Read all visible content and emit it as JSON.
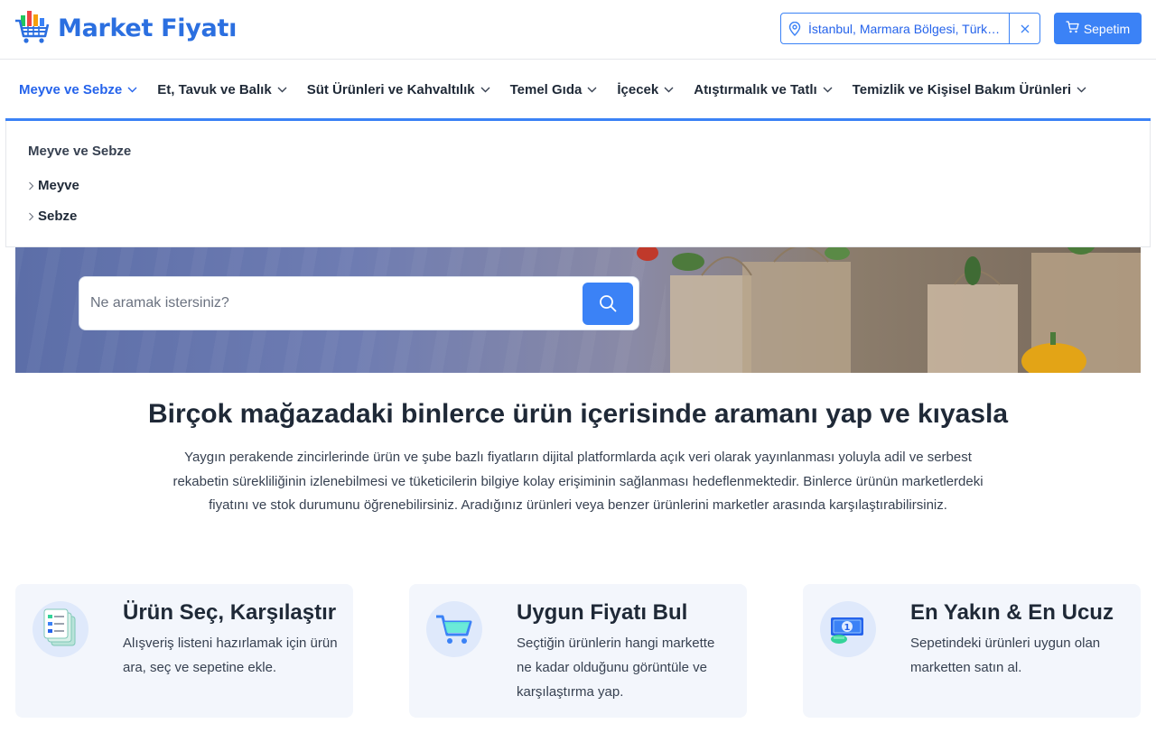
{
  "header": {
    "logo_text": "Market Fiyatı",
    "location_text": "İstanbul, Marmara Bölgesi, Türkiye",
    "cart_label": "Sepetim"
  },
  "nav": {
    "items": [
      {
        "label": "Meyve ve Sebze",
        "active": true
      },
      {
        "label": "Et, Tavuk ve Balık"
      },
      {
        "label": "Süt Ürünleri ve Kahvaltılık"
      },
      {
        "label": "Temel Gıda"
      },
      {
        "label": "İçecek"
      },
      {
        "label": "Atıştırmalık ve Tatlı"
      },
      {
        "label": "Temizlik ve Kişisel Bakım Ürünleri"
      }
    ]
  },
  "dropdown": {
    "title": "Meyve ve Sebze",
    "items": [
      "Meyve",
      "Sebze"
    ]
  },
  "search": {
    "placeholder": "Ne aramak istersiniz?"
  },
  "main": {
    "title": "Birçok mağazadaki binlerce ürün içerisinde aramanı yap ve kıyasla",
    "description": "Yaygın perakende zincirlerinde ürün ve şube bazlı fiyatların dijital platformlarda açık veri olarak yayınlanması yoluyla adil ve serbest rekabetin sürekliliğinin izlenebilmesi ve tüketicilerin bilgiye kolay erişiminin sağlanması hedeflenmektedir. Binlerce ürünün marketlerdeki fiyatını ve stok durumunu öğrenebilirsiniz. Aradığınız ürünleri veya benzer ürünlerini marketler arasında karşılaştırabilirsiniz."
  },
  "features": [
    {
      "title": "Ürün Seç, Karşılaştır",
      "desc": "Alışveriş listeni hazırlamak için ürün ara, seç ve sepetine ekle.",
      "icon": "list-icon"
    },
    {
      "title": "Uygun Fiyatı Bul",
      "desc": "Seçtiğin ürünlerin hangi markette ne kadar olduğunu görüntüle ve karşılaştırma yap.",
      "icon": "cart-icon"
    },
    {
      "title": "En Yakın & En Ucuz",
      "desc": "Sepetindeki ürünleri uygun olan marketten satın al.",
      "icon": "money-icon"
    }
  ],
  "colors": {
    "brand": "#2b6fe0",
    "accent": "#3b82f6"
  }
}
